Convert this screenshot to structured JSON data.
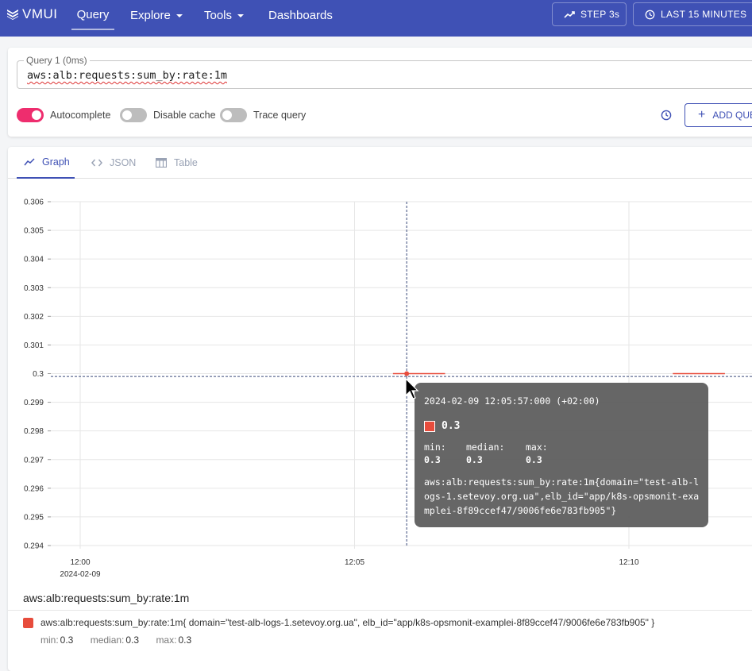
{
  "header": {
    "logo": "VMUI",
    "nav": [
      {
        "label": "Query",
        "active": true
      },
      {
        "label": "Explore",
        "dropdown": true
      },
      {
        "label": "Tools",
        "dropdown": true
      },
      {
        "label": "Dashboards"
      }
    ],
    "step_label": "STEP 3s",
    "time_range_label": "LAST 15 MINUTES",
    "bg_color": "#3f51b5"
  },
  "query": {
    "label": "Query 1 (0ms)",
    "value": "aws:alb:requests:sum_by:rate:1m",
    "toggles": [
      {
        "label": "Autocomplete",
        "on": true
      },
      {
        "label": "Disable cache",
        "on": false
      },
      {
        "label": "Trace query",
        "on": false
      }
    ],
    "add_query_label": "ADD QUERY",
    "accent_color": "#ee2d6e"
  },
  "tabs": [
    {
      "label": "Graph",
      "icon": "line-chart-icon",
      "active": true
    },
    {
      "label": "JSON",
      "icon": "code-icon"
    },
    {
      "label": "Table",
      "icon": "table-icon"
    }
  ],
  "chart_data": {
    "type": "line",
    "title": "",
    "xlabel": "",
    "ylabel": "",
    "ylim": [
      0.294,
      0.306
    ],
    "y_ticks": [
      "0.306",
      "0.305",
      "0.304",
      "0.303",
      "0.302",
      "0.301",
      "0.3",
      "0.299",
      "0.298",
      "0.297",
      "0.296",
      "0.295",
      "0.294"
    ],
    "x_ticks": [
      {
        "time": "12:00",
        "sub": "2024-02-09"
      },
      {
        "time": "12:05",
        "sub": ""
      },
      {
        "time": "12:10",
        "sub": ""
      }
    ],
    "grid": true,
    "series": [
      {
        "name": "aws:alb:requests:sum_by:rate:1m{domain=\"test-alb-logs-1.setevoy.org.ua\",elb_id=\"app/k8s-opsmonit-examplei-8f89ccef47/9006fe6e783fb905\"}",
        "color": "#e74c3c",
        "segments": [
          {
            "from": "12:05:42",
            "to": "12:06:39",
            "value": 0.3
          },
          {
            "from": "12:10:48",
            "to": "12:11:45",
            "value": 0.3
          }
        ]
      }
    ],
    "crosshair": {
      "time": "12:05:57",
      "value": 0.2999
    }
  },
  "tooltip": {
    "date": "2024-02-09 12:05:57:000 (+02:00)",
    "value": "0.3",
    "min_label": "min:",
    "min": "0.3",
    "median_label": "median:",
    "median": "0.3",
    "max_label": "max:",
    "max": "0.3",
    "label": "aws:alb:requests:sum_by:rate:1m{domain=\"test-alb-logs-1.setevoy.org.ua\",elb_id=\"app/k8s-opsmonit-examplei-8f89ccef47/9006fe6e783fb905\"}"
  },
  "legend": {
    "title": "aws:alb:requests:sum_by:rate:1m",
    "item": "aws:alb:requests:sum_by:rate:1m{ domain=\"test-alb-logs-1.setevoy.org.ua\", elb_id=\"app/k8s-opsmonit-examplei-8f89ccef47/9006fe6e783fb905\" }",
    "min_label": "min:",
    "min": "0.3",
    "median_label": "median:",
    "median": "0.3",
    "max_label": "max:",
    "max": "0.3"
  }
}
